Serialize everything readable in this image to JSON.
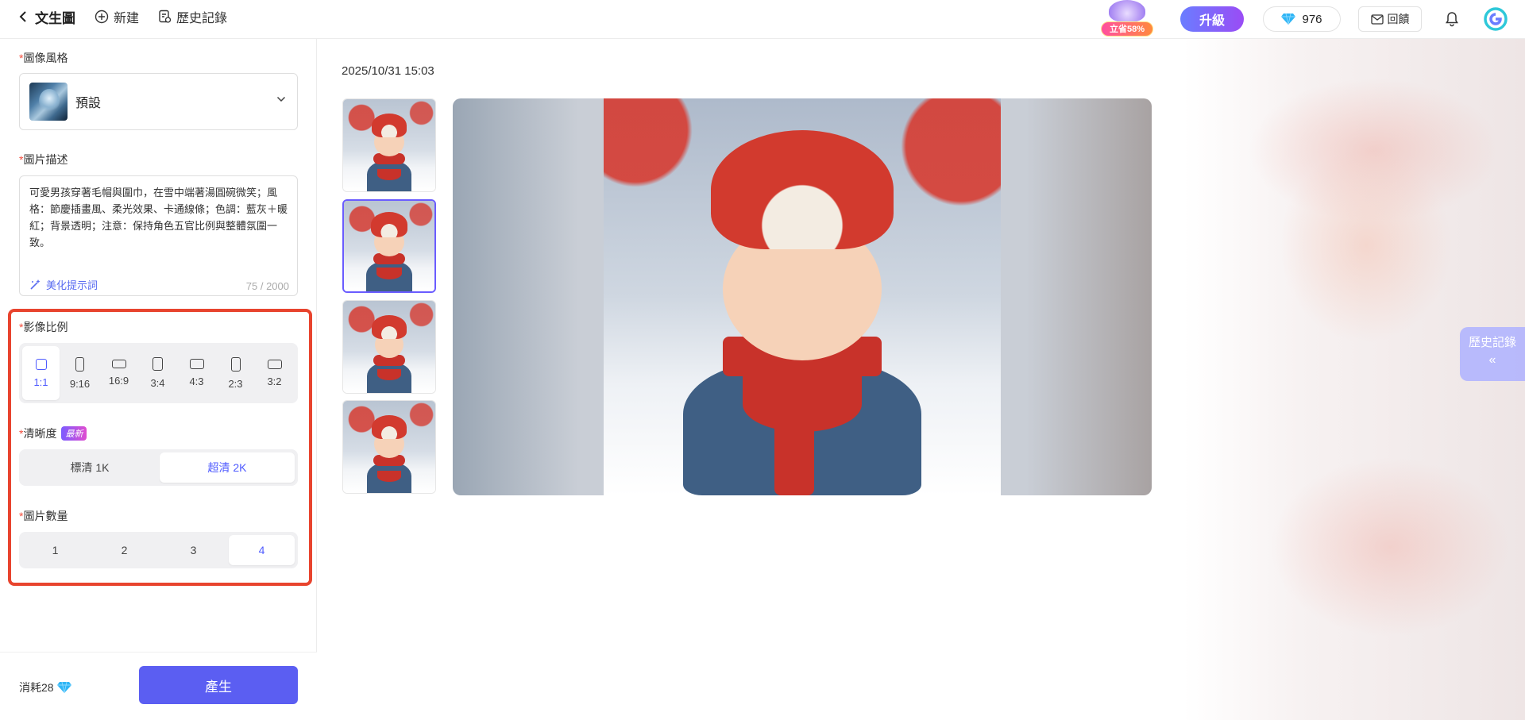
{
  "topbar": {
    "back_label": "文生圖",
    "new_label": "新建",
    "history_label": "歷史記錄",
    "promo_tag": "立省58%",
    "upgrade_label": "升級",
    "gem_count": "976",
    "feedback_label": "回饋"
  },
  "left_panel": {
    "style": {
      "label": "圖像風格",
      "value": "預設"
    },
    "description": {
      "label": "圖片描述",
      "text": "可愛男孩穿著毛帽與圍巾，在雪中端著湯圓碗微笑；風格：節慶插畫風、柔光效果、卡通線條；色調：藍灰＋暖紅；背景透明；注意：保持角色五官比例與整體氛圍一致。",
      "beautify_label": "美化提示詞",
      "char_count": "75 / 2000"
    },
    "aspect_ratio": {
      "label": "影像比例",
      "options": [
        "1:1",
        "9:16",
        "16:9",
        "3:4",
        "4:3",
        "2:3",
        "3:2"
      ],
      "selected": "1:1"
    },
    "resolution": {
      "label": "清晰度",
      "badge": "最新",
      "options": [
        "標清 1K",
        "超清 2K"
      ],
      "selected": "超清 2K"
    },
    "image_count": {
      "label": "圖片數量",
      "options": [
        "1",
        "2",
        "3",
        "4"
      ],
      "selected": "4"
    },
    "cost_label": "消耗28",
    "generate_label": "產生"
  },
  "main": {
    "timestamp": "2025/10/31 15:03",
    "thumbnails": 4,
    "selected_thumbnail": 2,
    "history_tab_label": "歷史記錄",
    "history_tab_arrows": "«"
  },
  "colors": {
    "accent": "#5b5ef2",
    "highlight_frame": "#e8442e",
    "required_mark": "#f24b3b"
  }
}
